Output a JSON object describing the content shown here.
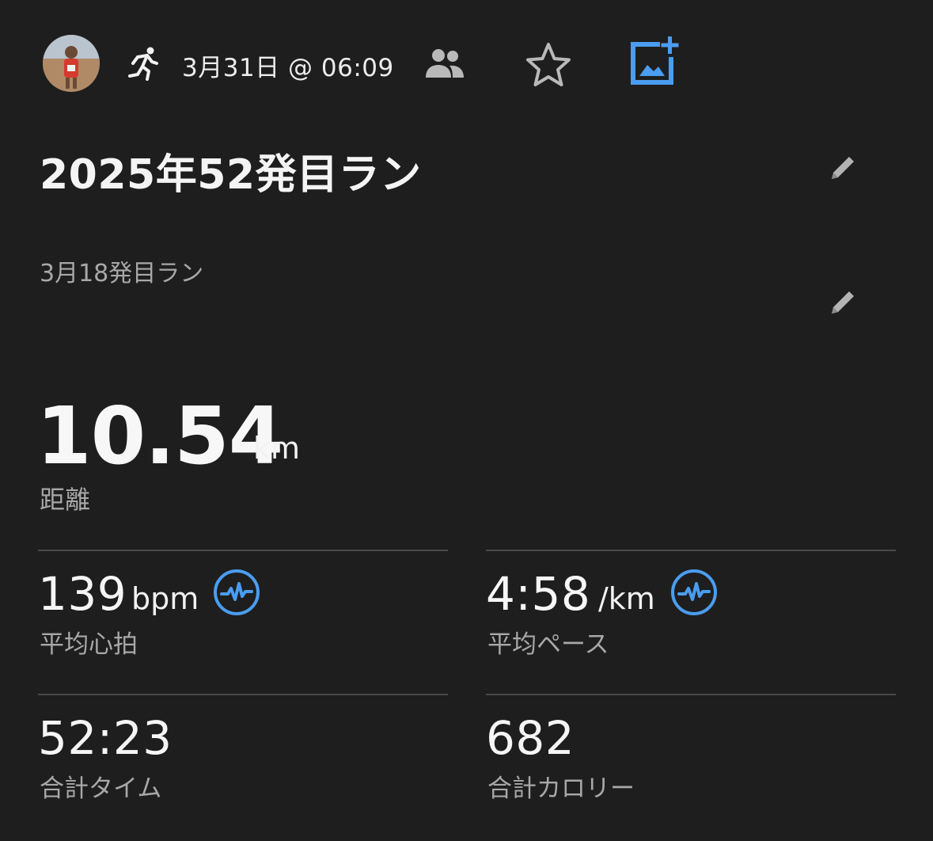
{
  "header": {
    "date": "3月31日 @ 06:09",
    "icons": {
      "activity": "running-person-icon",
      "privacy": "people-icon",
      "favorite": "star-icon",
      "add_photo": "add-photo-icon"
    }
  },
  "activity": {
    "title": "2025年52発目ラン",
    "description": "3月18発目ラン"
  },
  "distance": {
    "value": "10.54",
    "unit": "km",
    "label": "距離"
  },
  "stats": [
    {
      "value": "139",
      "unit": "bpm",
      "label": "平均心拍",
      "icon": "heart-rate-chart-icon"
    },
    {
      "value": "4:58",
      "unit": "/km",
      "label": "平均ペース",
      "icon": "pace-chart-icon"
    },
    {
      "value": "52:23",
      "unit": "",
      "label": "合計タイム"
    },
    {
      "value": "682",
      "unit": "",
      "label": "合計カロリー"
    }
  ],
  "colors": {
    "background": "#1e1e1e",
    "accent": "#4a9df0",
    "text": "#f2f2f2",
    "secondary_text": "#a8a8a8",
    "divider": "#4a4a4a"
  }
}
